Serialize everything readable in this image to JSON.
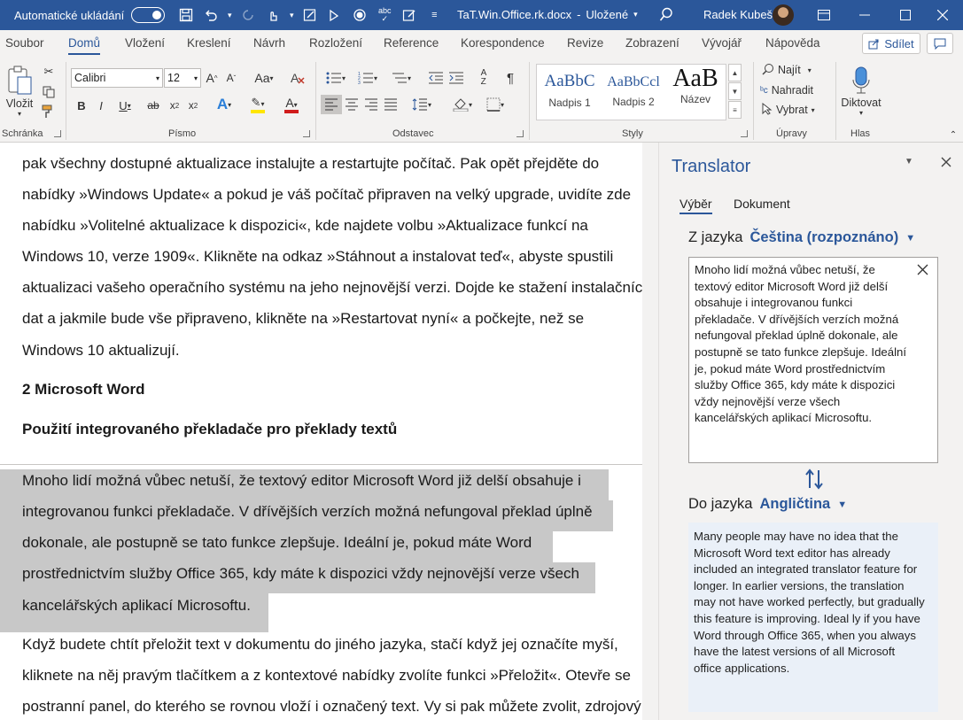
{
  "titlebar": {
    "autosave_label": "Automatické ukládání",
    "doc_title": "TaT.Win.Office.rk.docx",
    "saved_status": "Uložené",
    "user_name": "Radek Kubeš"
  },
  "tabs": [
    {
      "label": "Soubor"
    },
    {
      "label": "Domů"
    },
    {
      "label": "Vložení"
    },
    {
      "label": "Kreslení"
    },
    {
      "label": "Návrh"
    },
    {
      "label": "Rozložení"
    },
    {
      "label": "Reference"
    },
    {
      "label": "Korespondence"
    },
    {
      "label": "Revize"
    },
    {
      "label": "Zobrazení"
    },
    {
      "label": "Vývojář"
    },
    {
      "label": "Nápověda"
    }
  ],
  "share_label": "Sdílet",
  "ribbon": {
    "paste_label": "Vložit",
    "groups": {
      "clipboard": "Schránka",
      "font": "Písmo",
      "paragraph": "Odstavec",
      "styles": "Styly",
      "editing": "Úpravy",
      "voice": "Hlas"
    },
    "font_name": "Calibri",
    "font_size": "12",
    "styles": [
      {
        "sample": "AaBbC",
        "name": "Nadpis 1"
      },
      {
        "sample": "AaBbCcl",
        "name": "Nadpis 2"
      },
      {
        "sample": "AaB",
        "name": "Název"
      }
    ],
    "find_label": "Najít",
    "replace_label": "Nahradit",
    "select_label": "Vybrat",
    "dictate_label": "Diktovat"
  },
  "document": {
    "lines_top": [
      "pak všechny dostupné aktualizace instalujte a restartujte počítač. Pak opět přejděte do",
      "nabídky »Windows Update« a pokud je váš počítač připraven na velký upgrade, uvidíte zde",
      "nabídku »Volitelné aktualizace k dispozici«, kde najdete volbu »Aktualizace funkcí na",
      "Windows 10, verze 1909«. Klikněte na odkaz »Stáhnout a instalovat teď«, abyste spustili",
      "aktualizaci vašeho operačního systému na jeho nejnovější verzi. Dojde ke stažení instalačních",
      "dat a jakmile bude vše připraveno, klikněte na »Restartovat nyní« a počkejte, než se",
      "Windows 10 aktualizují."
    ],
    "heading1": "2 Microsoft Word",
    "heading2": "Použití integrovaného překladače pro překlady textů",
    "selected_lines": [
      "Mnoho lidí možná vůbec netuší, že textový editor Microsoft Word již delší obsahuje i",
      "integrovanou funkci překladače. V dřívějších verzích možná nefungoval překlad úplně",
      "dokonale, ale postupně se tato funkce zlepšuje. Ideální je, pokud máte Word",
      "prostřednictvím služby Office 365, kdy máte k dispozici vždy nejnovější verze všech",
      "kancelářských aplikací Microsoftu."
    ],
    "lines_bottom": [
      "Když budete chtít přeložit text v dokumentu do jiného jazyka, stačí když jej označíte myší,",
      "kliknete na něj pravým tlačítkem a z kontextové nabídky zvolíte funkci »Přeložit«. Otevře se",
      "postranní panel, do kterého se rovnou vloží i označený text. Vy si pak můžete zvolit, zdrojový"
    ]
  },
  "translator": {
    "title": "Translator",
    "tab_selection": "Výběr",
    "tab_document": "Dokument",
    "from_label": "Z jazyka",
    "from_value": "Čeština (rozpoznáno)",
    "to_label": "Do jazyka",
    "to_value": "Angličtina",
    "source_text": "Mnoho lidí možná vůbec netuší, že textový editor Microsoft Word již delší obsahuje i integrovanou funkci překladače. V dřívějších verzích možná nefungoval překlad úplně dokonale, ale postupně se tato funkce zlepšuje. Ideální je, pokud máte Word prostřednictvím služby Office 365, kdy máte k dispozici vždy nejnovější verze všech kancelářských aplikací Microsoftu.",
    "target_text": "Many people may have no idea that the Microsoft Word text editor has already included an integrated translator feature for longer. In earlier versions, the translation may not have worked perfectly, but gradually this feature is improving. Ideal ly if you have Word through Office 365, when you always have the latest versions of all Microsoft office applications."
  },
  "colors": {
    "accent": "#2b579a",
    "selection": "#c8c8c8",
    "pane_bg": "#f3f2f1",
    "target_bg": "#eaf0f8"
  }
}
